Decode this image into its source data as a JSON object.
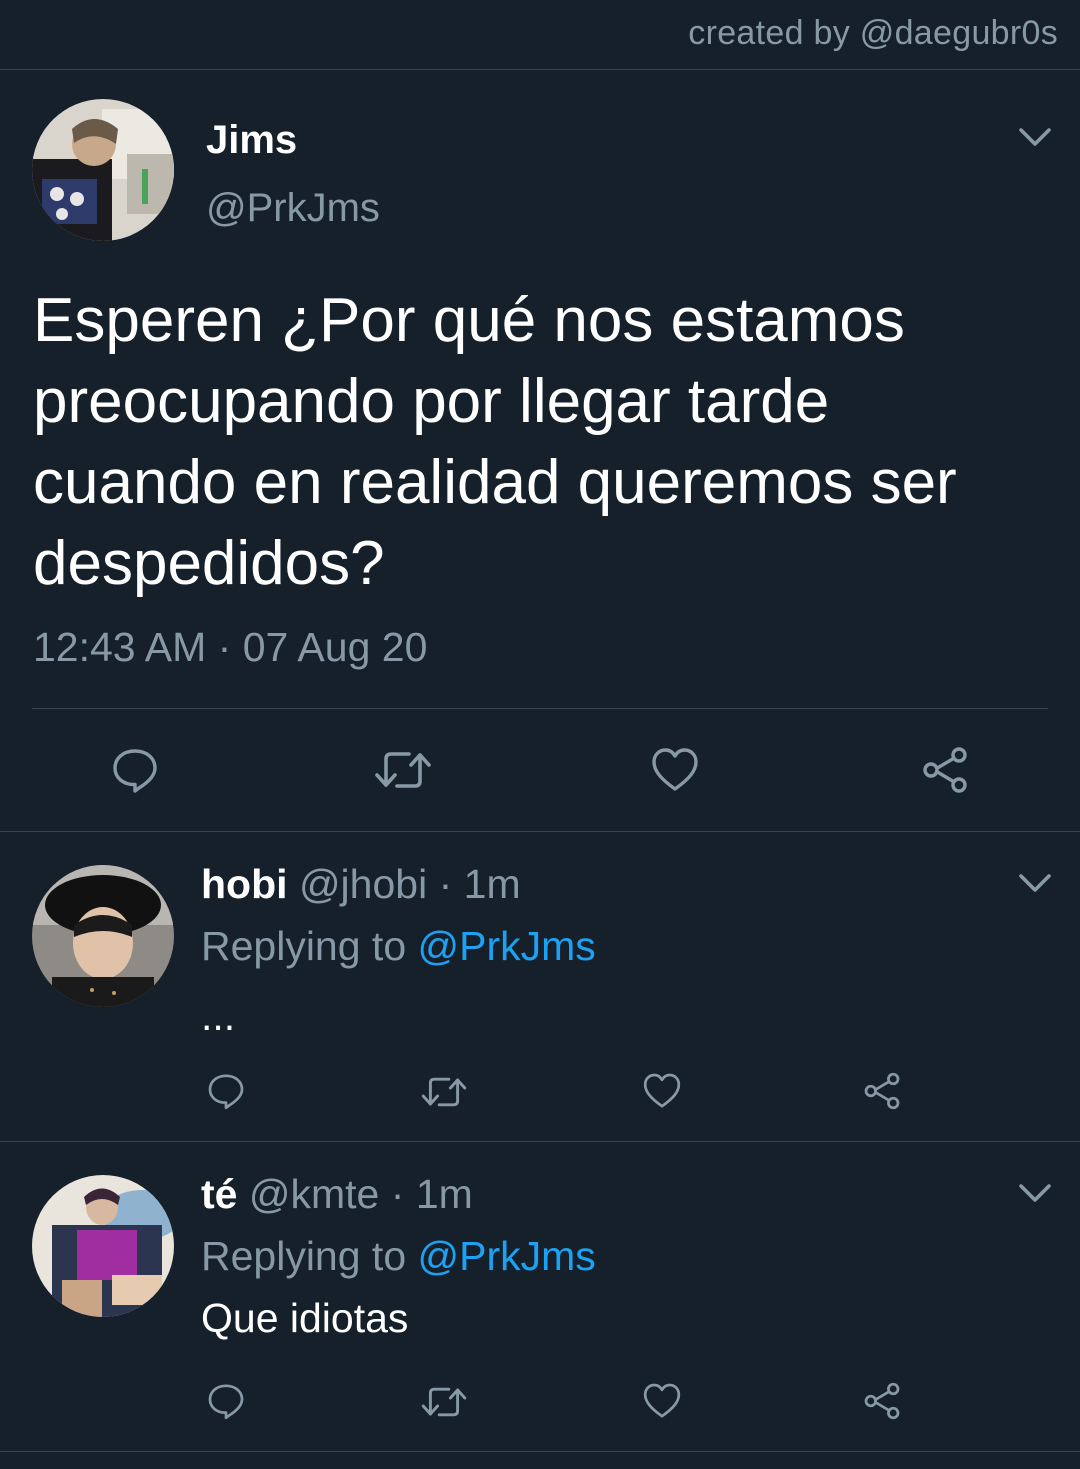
{
  "credit": "created by @daegubr0s",
  "main_tweet": {
    "name": "Jims",
    "handle": "@PrkJms",
    "text": "Esperen ¿Por qué nos estamos preocupando por llegar tarde cuando en realidad queremos ser despedidos?",
    "time": "12:43 AM",
    "date_separator": "·",
    "date": "07 Aug 20"
  },
  "replies": [
    {
      "name": "hobi",
      "handle": "@jhobi",
      "separator": "·",
      "time": "1m",
      "replying_label": "Replying to",
      "replying_to": "@PrkJms",
      "text": "..."
    },
    {
      "name": "té",
      "handle": "@kmte",
      "separator": "·",
      "time": "1m",
      "replying_label": "Replying to",
      "replying_to": "@PrkJms",
      "text": "Que idiotas"
    }
  ],
  "icons": [
    "chevron-down-icon",
    "reply-icon",
    "retweet-icon",
    "like-icon",
    "share-icon"
  ],
  "colors": {
    "background": "#15202b",
    "secondary_text": "#8899a6",
    "divider": "#38444d",
    "mention": "#1da1f2",
    "primary_text": "#ffffff"
  }
}
